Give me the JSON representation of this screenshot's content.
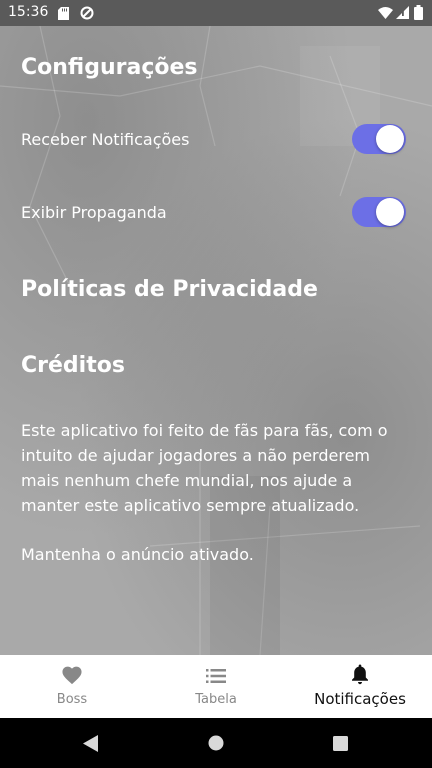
{
  "status_bar": {
    "time": "15:36",
    "icons": [
      "sd-card-icon",
      "data-saver-icon",
      "wifi-icon",
      "signal-icon",
      "battery-icon"
    ]
  },
  "settings": {
    "title": "Configurações",
    "notifications_label": "Receber Notificações",
    "notifications_enabled": true,
    "ads_label": "Exibir Propaganda",
    "ads_enabled": true
  },
  "privacy": {
    "title": "Políticas de Privacidade"
  },
  "credits": {
    "title": "Créditos",
    "paragraph1_lines": [
      "Este aplicativo foi feito de fãs para fãs, com o",
      "intuito de ajudar jogadores a não perderem",
      "mais nenhum chefe mundial, nos ajude a",
      "manter este aplicativo sempre atualizado."
    ],
    "paragraph2": "Mantenha o anúncio ativado."
  },
  "bottom_nav": {
    "items": [
      {
        "label": "Boss",
        "icon": "heart-icon",
        "active": false
      },
      {
        "label": "Tabela",
        "icon": "list-icon",
        "active": false
      },
      {
        "label": "Notificações",
        "icon": "bell-icon",
        "active": true
      }
    ]
  },
  "colors": {
    "toggle_track": "#6c6fe6",
    "status_bar": "#5a5a5a",
    "background": "#a9a9a9"
  }
}
